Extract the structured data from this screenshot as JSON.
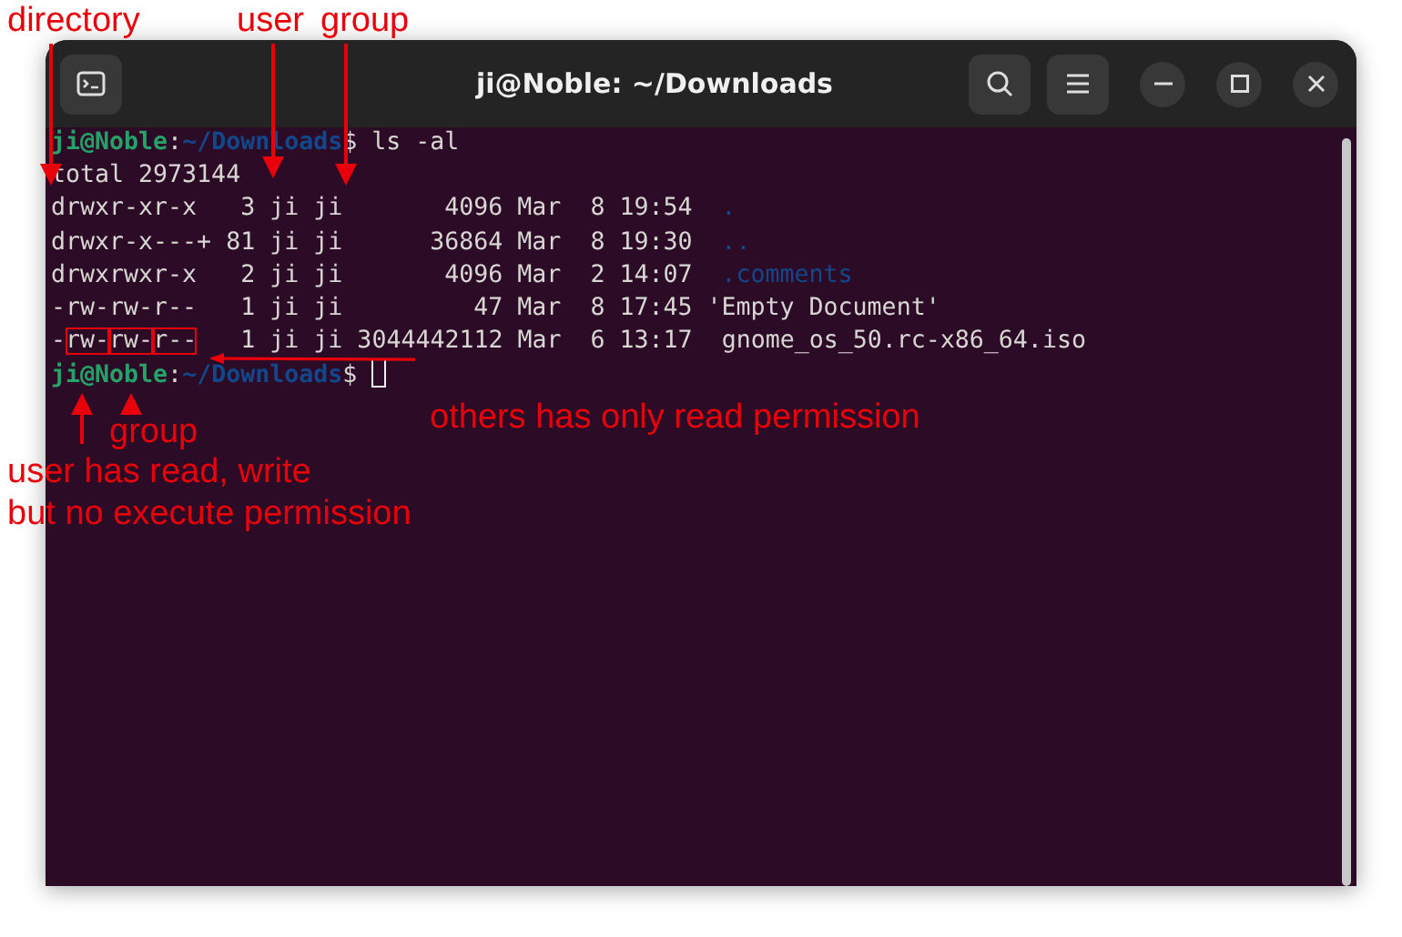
{
  "window": {
    "title": "ji@Noble: ~/Downloads"
  },
  "terminal": {
    "lines": [
      [
        {
          "kind": "user",
          "text": "ji@Noble"
        },
        {
          "kind": "plain",
          "text": ":"
        },
        {
          "kind": "path",
          "text": "~/Downloads"
        },
        {
          "kind": "plain",
          "text": "$ ls -al"
        }
      ],
      [
        {
          "kind": "plain",
          "text": "total 2973144"
        }
      ],
      [
        {
          "kind": "plain",
          "text": "drwxr-xr-x   3 ji ji       4096 Mar  8 19:54  "
        },
        {
          "kind": "dir",
          "text": "."
        }
      ],
      [
        {
          "kind": "plain",
          "text": "drwxr-x---+ 81 ji ji      36864 Mar  8 19:30  "
        },
        {
          "kind": "dir",
          "text": ".."
        }
      ],
      [
        {
          "kind": "plain",
          "text": "drwxrwxr-x   2 ji ji       4096 Mar  2 14:07  "
        },
        {
          "kind": "dir",
          "text": ".comments"
        }
      ],
      [
        {
          "kind": "plain",
          "text": "-rw-rw-r--   1 ji ji         47 Mar  8 17:45 'Empty Document'"
        }
      ],
      [
        {
          "kind": "plain",
          "text": "-"
        },
        {
          "kind": "boxed",
          "text": "rw-"
        },
        {
          "kind": "boxed",
          "text": "rw-"
        },
        {
          "kind": "boxed",
          "text": "r--"
        },
        {
          "kind": "plain",
          "text": "   1 ji ji 3044442112 Mar  6 13:17  gnome_os_50.rc-x86_64.iso"
        }
      ],
      [
        {
          "kind": "user",
          "text": "ji@Noble"
        },
        {
          "kind": "plain",
          "text": ":"
        },
        {
          "kind": "path",
          "text": "~/Downloads"
        },
        {
          "kind": "plain",
          "text": "$ "
        },
        {
          "kind": "cursor"
        }
      ]
    ]
  },
  "annotations": [
    {
      "text": "directory"
    },
    {
      "text": "user"
    },
    {
      "text": "group"
    },
    {
      "text": "group"
    },
    {
      "text": "others has only read permission"
    },
    {
      "text": "user has read, write\nbut no execute permission"
    }
  ]
}
